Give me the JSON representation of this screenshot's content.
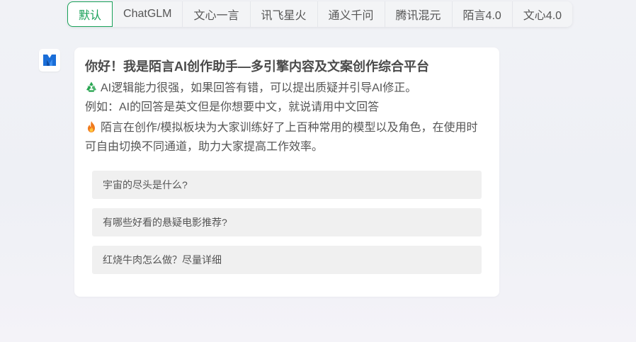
{
  "tabs": [
    {
      "label": "默认",
      "active": true
    },
    {
      "label": "ChatGLM",
      "active": false
    },
    {
      "label": "文心一言",
      "active": false
    },
    {
      "label": "讯飞星火",
      "active": false
    },
    {
      "label": "通义千问",
      "active": false
    },
    {
      "label": "腾讯混元",
      "active": false
    },
    {
      "label": "陌言4.0",
      "active": false
    },
    {
      "label": "文心4.0",
      "active": false
    }
  ],
  "avatar": {
    "icon": "brand-logo-icon",
    "color": "#1a6ed8"
  },
  "message": {
    "title": "你好！我是陌言AI创作助手—多引擎内容及文案创作综合平台",
    "line1": "AI逻辑能力很强，如果回答有错，可以提出质疑并引导AI修正。",
    "line1_icon": "recycle-icon",
    "line2": "例如：AI的回答是英文但是你想要中文，就说请用中文回答",
    "line3": "陌言在创作/模拟板块为大家训练好了上百种常用的模型以及角色，在使用时",
    "line3_icon": "fire-icon",
    "line4": "可自由切换不同通道，助力大家提高工作效率。"
  },
  "suggestions": [
    "宇宙的尽头是什么?",
    "有哪些好看的悬疑电影推荐?",
    "红烧牛肉怎么做？尽量详细"
  ],
  "colors": {
    "accent": "#18a058",
    "card_bg": "#ffffff",
    "suggestion_bg": "#f0f0f0",
    "recycle_icon": "#2aa652",
    "fire_icon": "#f07a1c"
  }
}
